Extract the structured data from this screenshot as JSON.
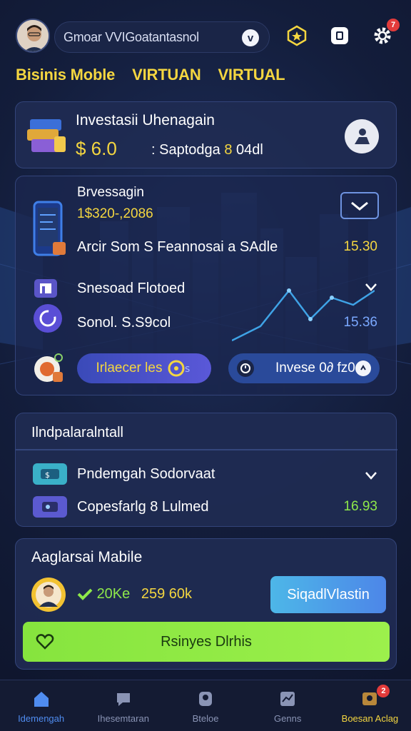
{
  "header": {
    "search_text": "Gmoar VVIGoatantasnol",
    "notification_count": "7"
  },
  "subtitle": {
    "part1": "Bisinis Moble",
    "part2": "VIRTUAN",
    "part3": "VIRTUAL"
  },
  "investment_card": {
    "title": "Investasii Uhenagain",
    "amount": "$ 6.0",
    "amount_sub_text": ": Saptodga",
    "amount_sub_highlight": "8",
    "amount_sub_tail": "04dl"
  },
  "portfolio_card": {
    "title": "Brvessagin",
    "number": "1$320-,2086",
    "rows": [
      {
        "label": "Arcir Som S Feannosai a SAdle",
        "value": "15.30",
        "value_color": "#f4d640"
      },
      {
        "label": "Snesoad Flotoed",
        "value": "",
        "value_color": "#ffffff"
      },
      {
        "label": "Sonol. S.S9col",
        "value": "15.36",
        "value_color": "#7aa8ff"
      }
    ],
    "button_left": "Irlaecer les",
    "button_right": "Invese 0∂ fz0"
  },
  "list_card": {
    "title": "Ilndpalaralntall",
    "rows": [
      {
        "label": "Pndemgah Sodorvaat",
        "value": ""
      },
      {
        "label": "Copesfarlg 8 Lulmed",
        "value": "16.93"
      }
    ]
  },
  "promo_card": {
    "title": "Aaglarsai Mabile",
    "stat1": "20Ke",
    "stat2": "259",
    "stat3": "60k",
    "side_button": "SiqadlVlastin",
    "cta_label": "Rsinyes Dlrhis"
  },
  "bottom_nav": {
    "items": [
      {
        "label": "Idemengah"
      },
      {
        "label": "Ihesemtaran"
      },
      {
        "label": "Bteloe"
      },
      {
        "label": "Genns"
      },
      {
        "label": "Boesan Aclag"
      }
    ],
    "badge": "2"
  },
  "colors": {
    "accent_yellow": "#f4d640",
    "accent_green": "#8ee84a",
    "accent_blue": "#4f8cf0",
    "card_bg": "#1f2b52"
  }
}
